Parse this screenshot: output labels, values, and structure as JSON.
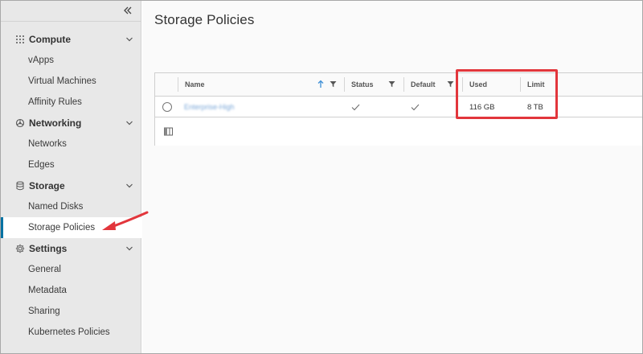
{
  "sidebar": {
    "groups": [
      {
        "label": "Compute",
        "icon": "grid-dots-icon",
        "items": [
          "vApps",
          "Virtual Machines",
          "Affinity Rules"
        ]
      },
      {
        "label": "Networking",
        "icon": "network-icon",
        "items": [
          "Networks",
          "Edges"
        ]
      },
      {
        "label": "Storage",
        "icon": "database-icon",
        "items": [
          "Named Disks",
          "Storage Policies"
        ]
      },
      {
        "label": "Settings",
        "icon": "gear-icon",
        "items": [
          "General",
          "Metadata",
          "Sharing",
          "Kubernetes Policies"
        ]
      }
    ],
    "active_item": "Storage Policies"
  },
  "main": {
    "title": "Storage Policies",
    "grid": {
      "columns": [
        "Name",
        "Status",
        "Default",
        "Used",
        "Limit"
      ],
      "rows": [
        {
          "name": "Enterprise-High",
          "status": "check",
          "default": "check",
          "used": "116 GB",
          "limit": "8 TB"
        }
      ]
    }
  },
  "colors": {
    "sidebar_bg": "#e8e8e8",
    "active_border": "#0072a3",
    "sort_arrow": "#3d8fd6",
    "annotation_red": "#e2363c",
    "link_blue": "#7aa7d8"
  }
}
